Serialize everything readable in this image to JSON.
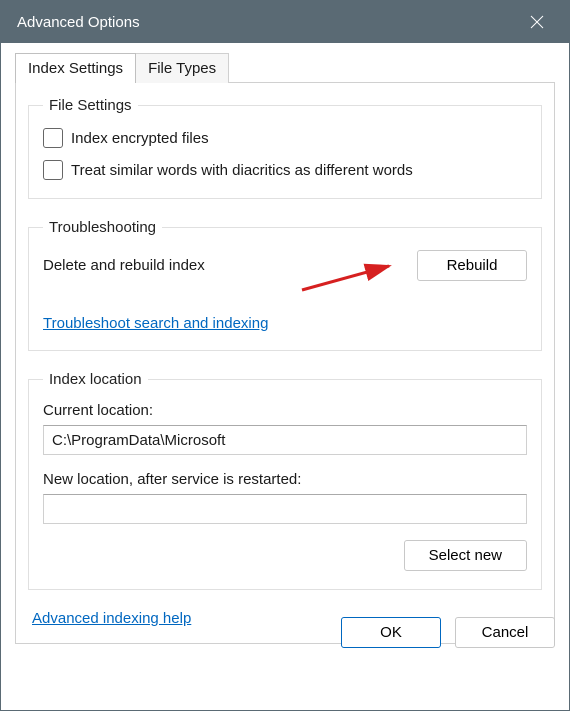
{
  "title": "Advanced Options",
  "tabs": {
    "settings": "Index Settings",
    "filetypes": "File Types"
  },
  "file_settings": {
    "legend": "File Settings",
    "opt1": "Index encrypted files",
    "opt2": "Treat similar words with diacritics as different words"
  },
  "troubleshooting": {
    "legend": "Troubleshooting",
    "deleteLabel": "Delete and rebuild index",
    "rebuildBtn": "Rebuild",
    "link": "Troubleshoot search and indexing"
  },
  "index_location": {
    "legend": "Index location",
    "currentLabel": "Current location:",
    "currentPath": "C:\\ProgramData\\Microsoft",
    "newLabel": "New location, after service is restarted:",
    "selectBtn": "Select new"
  },
  "helpLink": "Advanced indexing help",
  "buttons": {
    "ok": "OK",
    "cancel": "Cancel"
  }
}
